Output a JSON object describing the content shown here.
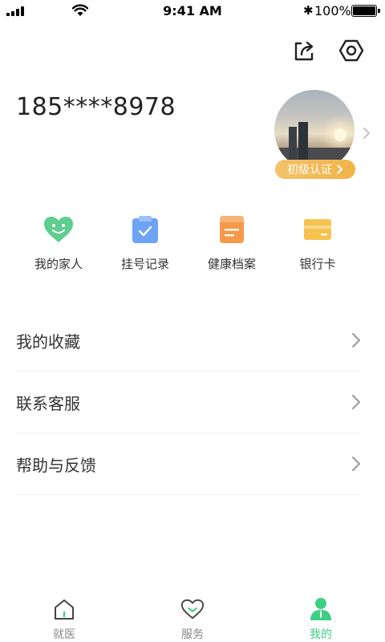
{
  "status_bar": {
    "time": "9:41 AM",
    "battery_pct": "100%",
    "icons": [
      "signal-icon",
      "wifi-icon",
      "bluetooth-icon",
      "battery-icon"
    ]
  },
  "header": {
    "actions": [
      "share-icon",
      "settings-icon"
    ]
  },
  "profile": {
    "phone": "185****8978",
    "cert_badge": "初级认证"
  },
  "quick_actions": [
    {
      "label": "我的家人",
      "icon": "heart-smile-icon",
      "color": "#5ccf8e"
    },
    {
      "label": "挂号记录",
      "icon": "clipboard-check-icon",
      "color": "#6ea3f5"
    },
    {
      "label": "健康档案",
      "icon": "document-icon",
      "color": "#f49a4a"
    },
    {
      "label": "银行卡",
      "icon": "card-icon",
      "color": "#f6c350"
    }
  ],
  "menu": [
    {
      "label": "我的收藏"
    },
    {
      "label": "联系客服"
    },
    {
      "label": "帮助与反馈"
    }
  ],
  "tabbar": {
    "tabs": [
      {
        "label": "就医",
        "icon": "home-icon",
        "active": false
      },
      {
        "label": "服务",
        "icon": "heart-icon",
        "active": false
      },
      {
        "label": "我的",
        "icon": "person-icon",
        "active": true
      }
    ],
    "active_color": "#3ecf85"
  }
}
